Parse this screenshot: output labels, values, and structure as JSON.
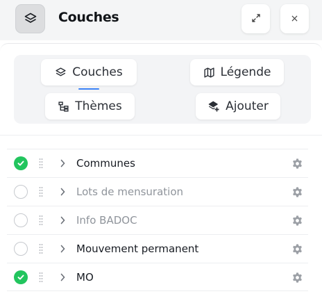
{
  "header": {
    "title": "Couches",
    "icon": "layers-icon",
    "expand_icon": "expand-icon",
    "close_label": "×"
  },
  "tabs": [
    {
      "label": "Couches",
      "icon": "layers-icon",
      "active": true
    },
    {
      "label": "Légende",
      "icon": "map-icon",
      "active": false
    },
    {
      "label": "Thèmes",
      "icon": "tree-icon",
      "active": false
    },
    {
      "label": "Ajouter",
      "icon": "add-layer-icon",
      "active": false
    }
  ],
  "layers": [
    {
      "name": "Communes",
      "visible": true
    },
    {
      "name": "Lots de mensuration",
      "visible": false
    },
    {
      "name": "Info BADOC",
      "visible": false
    },
    {
      "name": "Mouvement permanent",
      "visible": false
    },
    {
      "name": "MO",
      "visible": true
    }
  ],
  "colors": {
    "accent": "#3b82f6",
    "check": "#22c55e",
    "muted_text": "#8f949b",
    "gear": "#9ca0a6"
  }
}
